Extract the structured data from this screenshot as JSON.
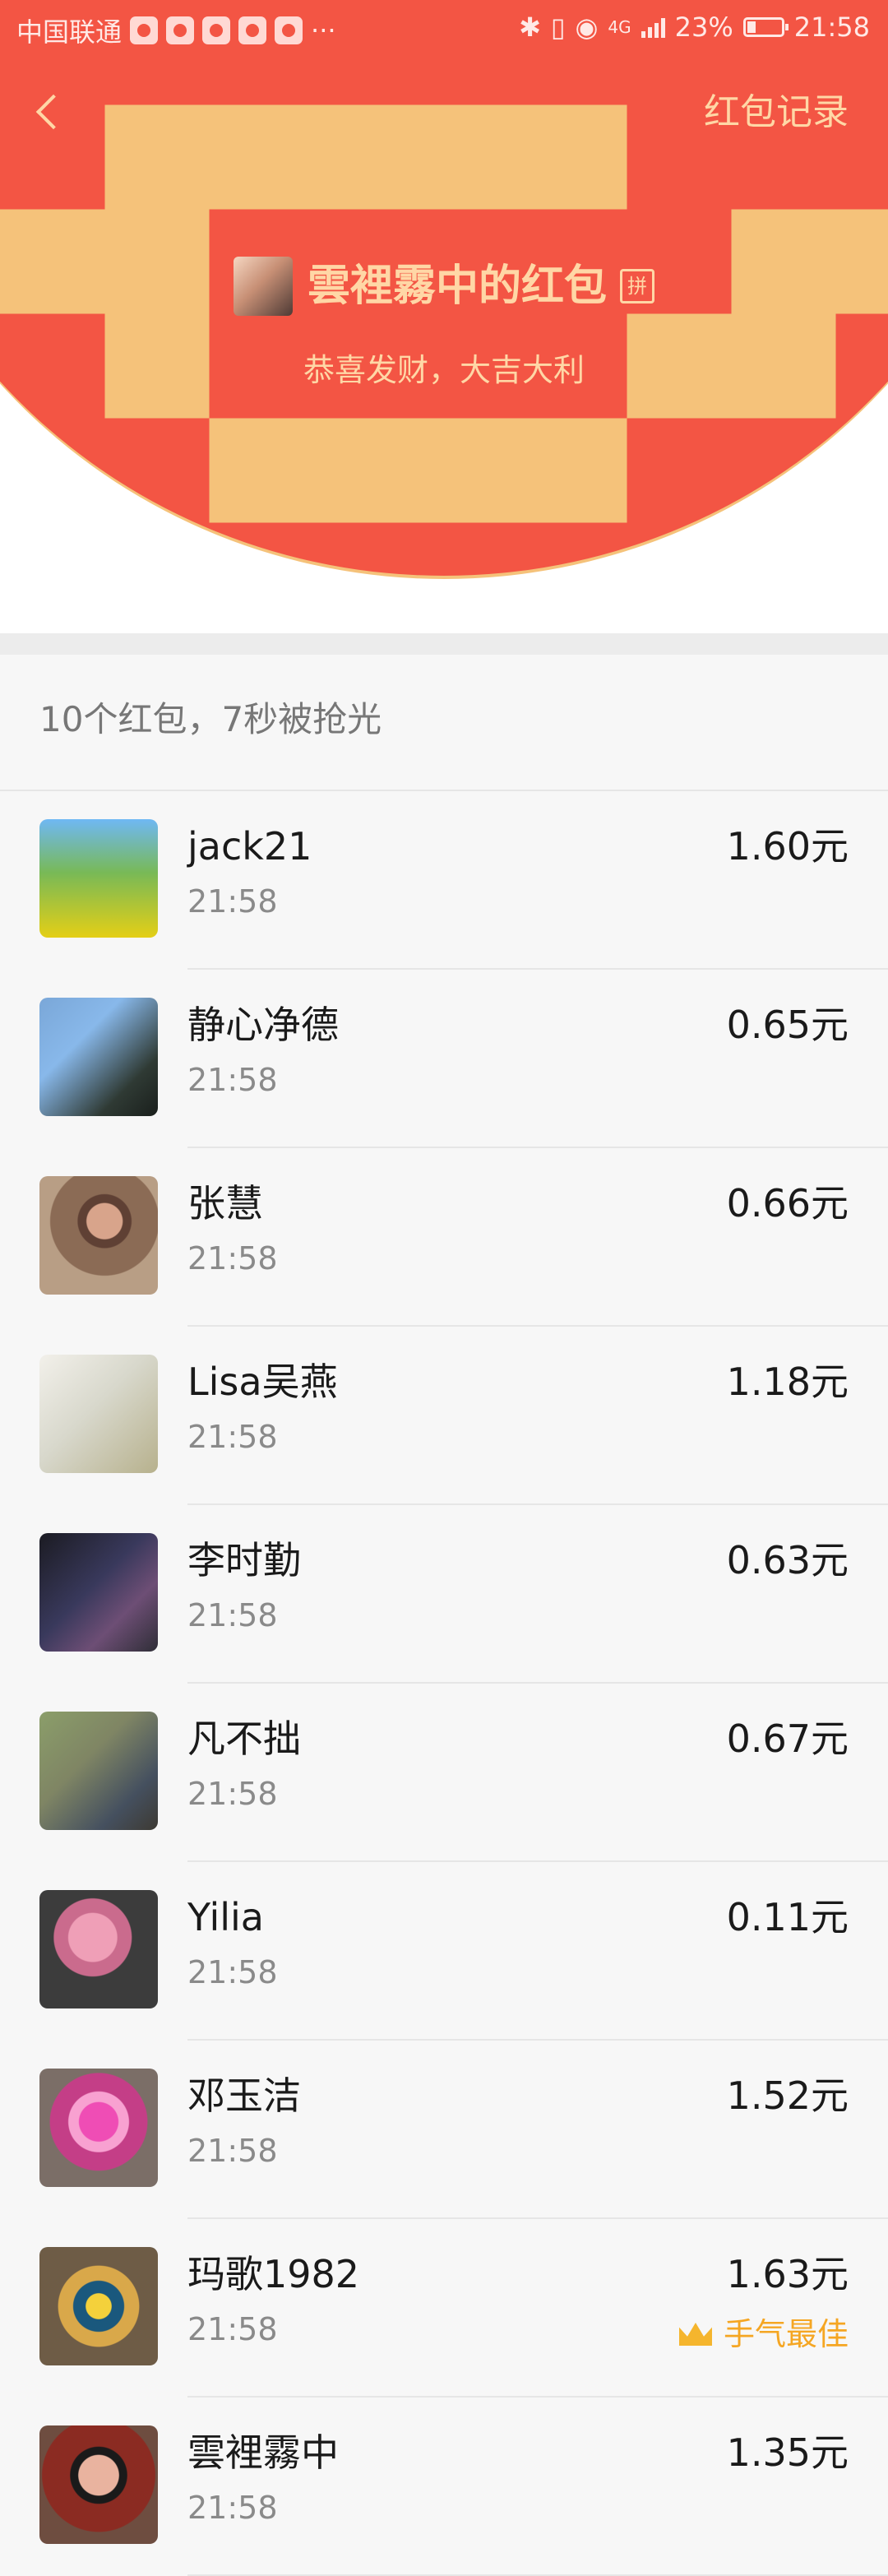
{
  "status_bar": {
    "carrier": "中国联通",
    "more": "···",
    "network": "4G",
    "battery_percent": "23%",
    "time": "21:58"
  },
  "header": {
    "back_icon": "chevron-left-icon",
    "record_label": "红包记录",
    "sender_title": "雲裡霧中的红包",
    "pin_label": "拼",
    "greeting": "恭喜发财，大吉大利"
  },
  "summary": "10个红包，7秒被抢光",
  "records": [
    {
      "name": "jack21",
      "time": "21:58",
      "amount": "1.60元"
    },
    {
      "name": "静心净德",
      "time": "21:58",
      "amount": "0.65元"
    },
    {
      "name": "张慧",
      "time": "21:58",
      "amount": "0.66元"
    },
    {
      "name": "Lisa吴燕",
      "time": "21:58",
      "amount": "1.18元"
    },
    {
      "name": "李时勤",
      "time": "21:58",
      "amount": "0.63元"
    },
    {
      "name": "凡不拙",
      "time": "21:58",
      "amount": "0.67元"
    },
    {
      "name": "Yilia",
      "time": "21:58",
      "amount": "0.11元"
    },
    {
      "name": "邓玉洁",
      "time": "21:58",
      "amount": "1.52元"
    },
    {
      "name": "玛歌1982",
      "time": "21:58",
      "amount": "1.63元",
      "best": "手气最佳"
    },
    {
      "name": "雲裡霧中",
      "time": "21:58",
      "amount": "1.35元"
    }
  ],
  "colors": {
    "header_red": "#f35544",
    "gold_text": "#ffd7a6",
    "best_orange": "#f5a623"
  }
}
